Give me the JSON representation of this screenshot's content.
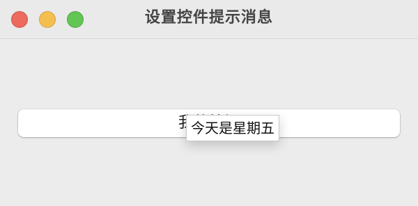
{
  "window": {
    "title": "设置控件提示消息",
    "traffic_lights": {
      "close_color": "#ed6a5e",
      "minimize_color": "#f5bf4f",
      "zoom_color": "#62c554"
    }
  },
  "main": {
    "button_label": "我的按钮",
    "tooltip_text": "今天是星期五"
  }
}
